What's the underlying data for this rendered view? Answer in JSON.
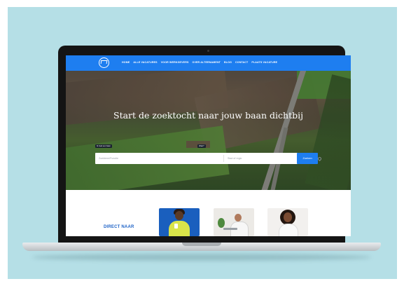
{
  "colors": {
    "background": "#b5dfe6",
    "nav": "#1e7ef0",
    "accent": "#1e63c7",
    "laptop": "#141414"
  },
  "nav": {
    "logo_icon": "logo-icon",
    "links": [
      "HOME",
      "ALLE VACATURES",
      "VOOR WERKGEVERS",
      "OVER ALTERNAMENT",
      "BLOG",
      "CONTACT",
      "PLAATS VACATURE"
    ]
  },
  "hero": {
    "title": "Start de zoektocht naar jouw baan dichtbij",
    "tag_left": "Ik zoek een baan",
    "tag_right": "Waar?",
    "search_placeholder": "Zoekterm/Functie",
    "location_placeholder": "Stad of regio",
    "location_icon": "location-pin-icon",
    "search_button": "Zoeken"
  },
  "lower": {
    "heading": "DIRECT NAAR"
  }
}
